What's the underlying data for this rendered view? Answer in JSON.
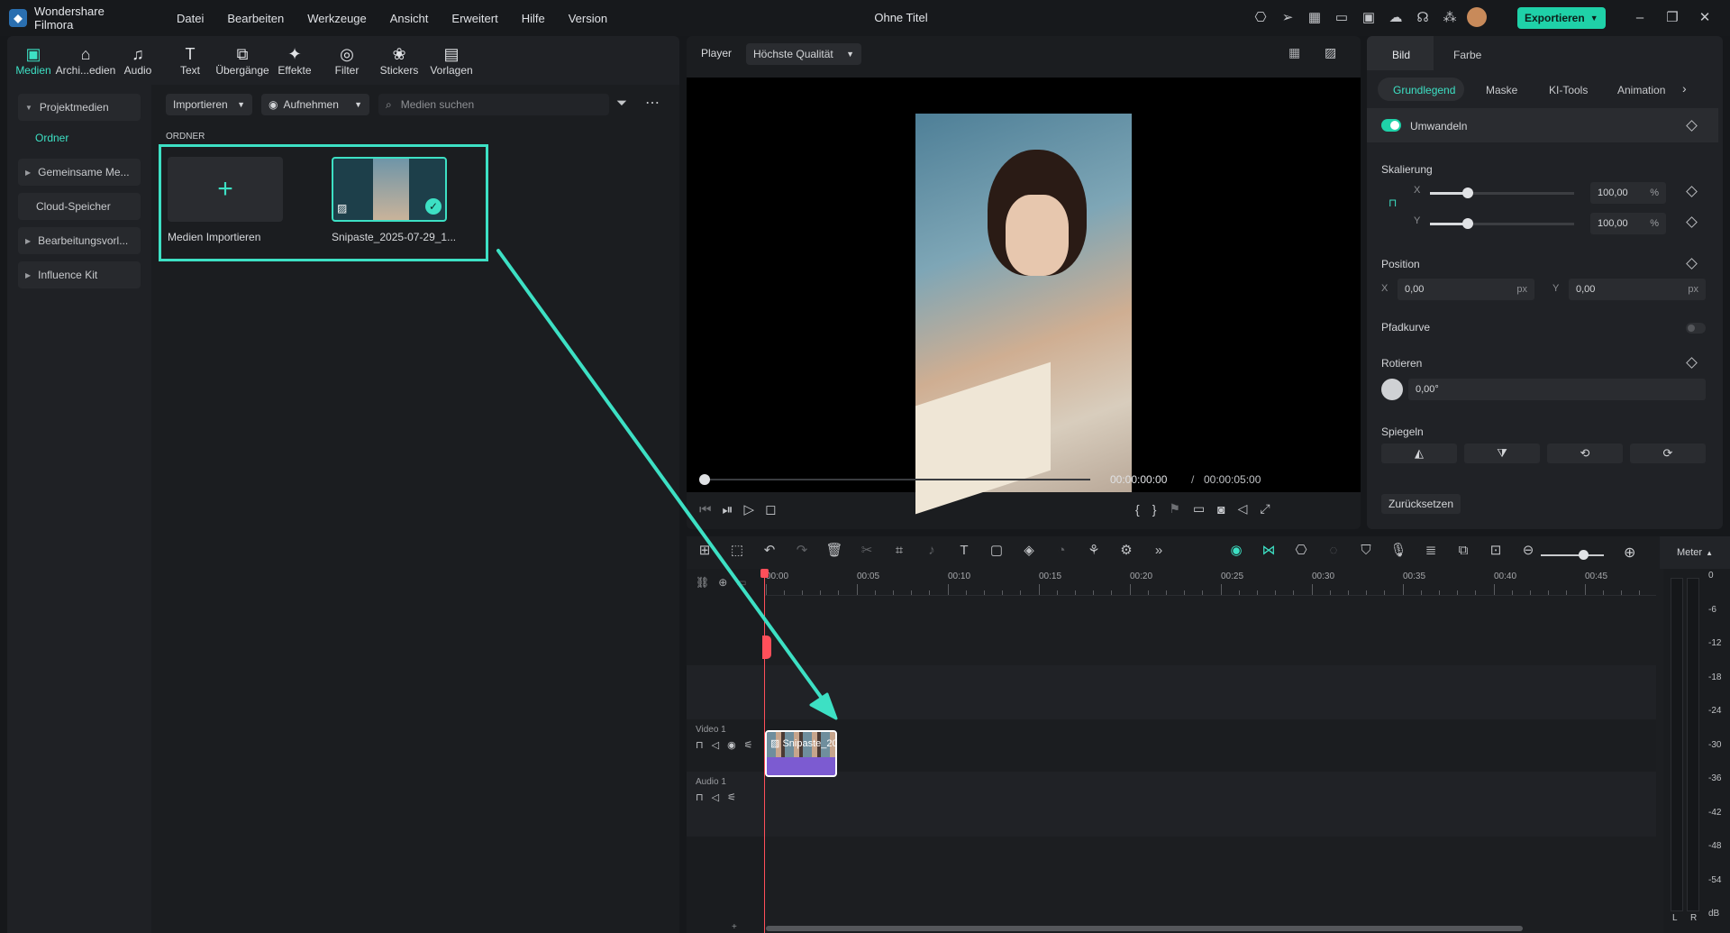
{
  "app": {
    "name": "Wondershare Filmora",
    "doc_title": "Ohne Titel",
    "export_label": "Exportieren"
  },
  "menu": [
    "Datei",
    "Bearbeiten",
    "Werkzeuge",
    "Ansicht",
    "Erweitert",
    "Hilfe",
    "Version"
  ],
  "toolbar": [
    {
      "label": "Medien",
      "icon": "media-icon",
      "glyph": "▣"
    },
    {
      "label": "Archi...edien",
      "icon": "store-icon",
      "glyph": "⌂"
    },
    {
      "label": "Audio",
      "icon": "music-icon",
      "glyph": "♫"
    },
    {
      "label": "Text",
      "icon": "text-icon",
      "glyph": "T"
    },
    {
      "label": "Übergänge",
      "icon": "transition-icon",
      "glyph": "⧉"
    },
    {
      "label": "Effekte",
      "icon": "effects-icon",
      "glyph": "✦"
    },
    {
      "label": "Filter",
      "icon": "filter-icon",
      "glyph": "◎"
    },
    {
      "label": "Stickers",
      "icon": "sticker-icon",
      "glyph": "❀"
    },
    {
      "label": "Vorlagen",
      "icon": "template-icon",
      "glyph": "▤"
    }
  ],
  "leftnav": {
    "projektmedien": "Projektmedien",
    "ordner": "Ordner",
    "items": [
      "Gemeinsame Me...",
      "Cloud-Speicher",
      "Bearbeitungsvorl...",
      "Influence Kit"
    ]
  },
  "media": {
    "import_label": "Importieren",
    "record_label": "Aufnehmen",
    "search_placeholder": "Medien suchen",
    "folder_heading": "ORDNER",
    "import_tile_label": "Medien Importieren",
    "clip_label": "Snipaste_2025-07-29_1..."
  },
  "player": {
    "label": "Player",
    "quality": "Höchste Qualität",
    "current_time": "00:00:00:00",
    "separator": "/",
    "total_time": "00:00:05:00"
  },
  "props": {
    "tabs": [
      "Bild",
      "Farbe"
    ],
    "subtabs": [
      "Grundlegend",
      "Maske",
      "KI-Tools",
      "Animation"
    ],
    "transform": "Umwandeln",
    "scale": "Skalierung",
    "x": "X",
    "y": "Y",
    "scale_x": "100,00",
    "scale_y": "100,00",
    "percent": "%",
    "position": "Position",
    "pos_x": "0,00",
    "pos_y": "0,00",
    "px": "px",
    "path_curve": "Pfadkurve",
    "rotate": "Rotieren",
    "rotate_value": "0,00°",
    "mirror": "Spiegeln",
    "reset": "Zurücksetzen"
  },
  "timeline": {
    "ruler": [
      "00:00",
      "00:05",
      "00:10",
      "00:15",
      "00:20",
      "00:25",
      "00:30",
      "00:35",
      "00:40",
      "00:45"
    ],
    "meter_label": "Meter",
    "meter_scale": [
      "0",
      "-6",
      "-12",
      "-18",
      "-24",
      "-30",
      "-36",
      "-42",
      "-48",
      "-54",
      "dB"
    ],
    "meter_lr": [
      "L",
      "R"
    ],
    "video_track": "Video 1",
    "audio_track": "Audio 1",
    "clip_label": "Snipaste_20..."
  },
  "colors": {
    "accent": "#3de0c4",
    "clip": "#7c5bd1",
    "playhead": "#ff4f5a"
  }
}
